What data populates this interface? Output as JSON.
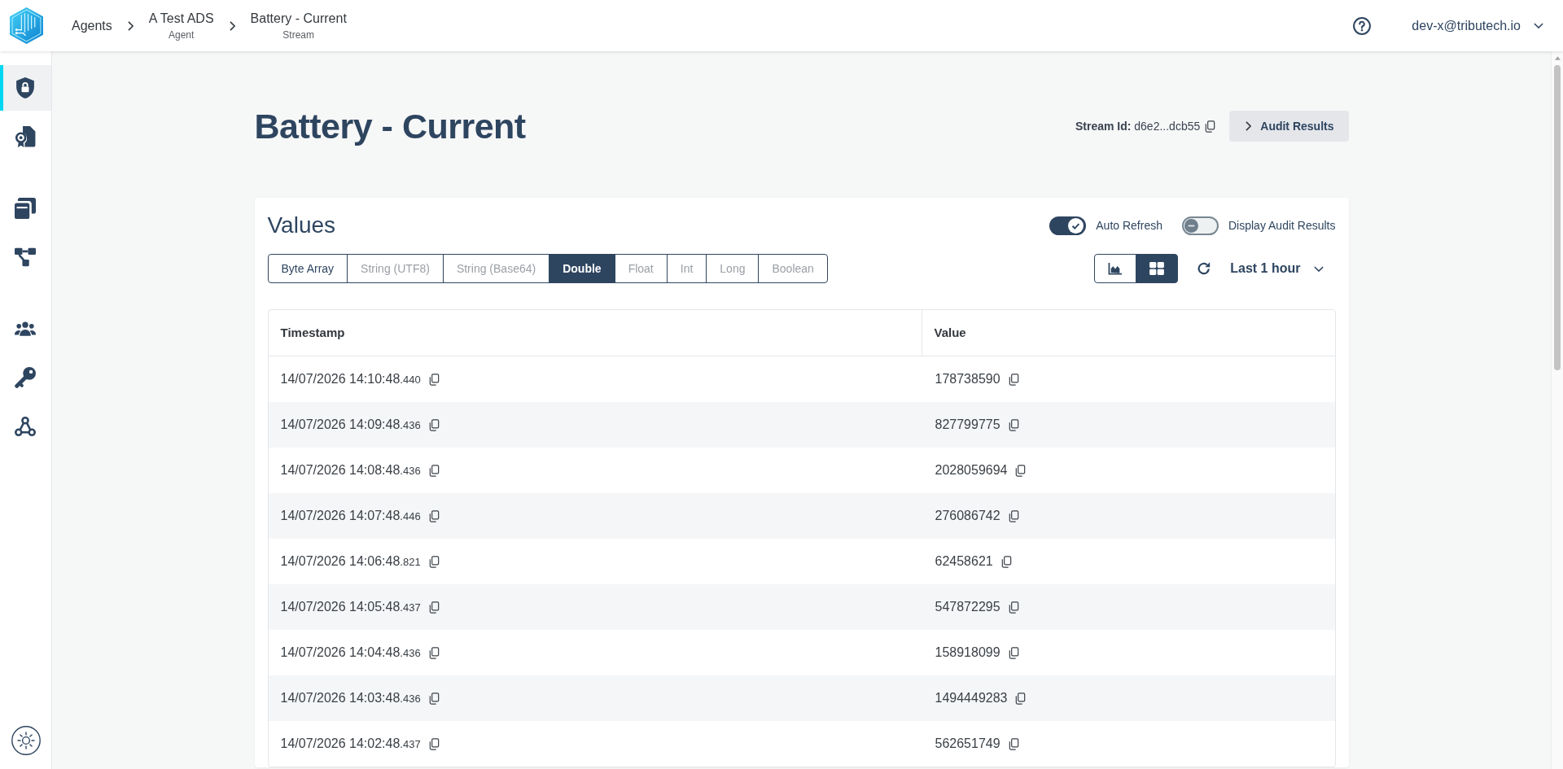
{
  "header": {
    "breadcrumbs": [
      {
        "label": "Agents"
      },
      {
        "label": "A Test ADS",
        "type": "Agent"
      },
      {
        "label": "Battery - Current",
        "type": "Stream"
      }
    ],
    "user": "dev-x@tributech.io"
  },
  "sidebar": {
    "groups": [
      {
        "items": [
          {
            "selected": true
          },
          {
            "selected": false
          }
        ]
      },
      {
        "items": [
          {
            "selected": false
          },
          {
            "selected": false
          }
        ]
      },
      {
        "items": [
          {
            "selected": false
          },
          {
            "selected": false
          },
          {
            "selected": false
          }
        ]
      }
    ]
  },
  "page": {
    "title": "Battery - Current",
    "stream_id": "**Stream Id:** d6e2...dcb55",
    "audit_button": "Audit Results"
  },
  "values_card": {
    "title": "Values",
    "switches": [
      {
        "label": "Auto Refresh",
        "on": true
      },
      {
        "label": "Display Audit Results",
        "on": false
      }
    ],
    "data_types": [
      {
        "label": "Byte Array",
        "selected": false,
        "disabled": false
      },
      {
        "label": "String (UTF8)",
        "selected": false,
        "disabled": true
      },
      {
        "label": "String (Base64)",
        "selected": false,
        "disabled": true
      },
      {
        "label": "Double",
        "selected": true,
        "disabled": false
      },
      {
        "label": "Float",
        "selected": false,
        "disabled": true
      },
      {
        "label": "Int",
        "selected": false,
        "disabled": true
      },
      {
        "label": "Long",
        "selected": false,
        "disabled": true
      },
      {
        "label": "Boolean",
        "selected": false,
        "disabled": true
      }
    ],
    "views": [
      {
        "selected": false
      },
      {
        "selected": true
      }
    ],
    "time_range": "Last 1 hour",
    "table": {
      "columns": [
        "Timestamp",
        "Value"
      ],
      "rows": [
        {
          "timestamp": "14/07/2026 14:10:48",
          "milliseconds": ".440",
          "value": "178738590"
        },
        {
          "timestamp": "14/07/2026 14:09:48",
          "milliseconds": ".436",
          "value": "827799775"
        },
        {
          "timestamp": "14/07/2026 14:08:48",
          "milliseconds": ".436",
          "value": "2028059694"
        },
        {
          "timestamp": "14/07/2026 14:07:48",
          "milliseconds": ".446",
          "value": "276086742"
        },
        {
          "timestamp": "14/07/2026 14:06:48",
          "milliseconds": ".821",
          "value": "62458621"
        },
        {
          "timestamp": "14/07/2026 14:05:48",
          "milliseconds": ".437",
          "value": "547872295"
        },
        {
          "timestamp": "14/07/2026 14:04:48",
          "milliseconds": ".436",
          "value": "158918099"
        },
        {
          "timestamp": "14/07/2026 14:03:48",
          "milliseconds": ".436",
          "value": "1494449283"
        },
        {
          "timestamp": "14/07/2026 14:02:48",
          "milliseconds": ".437",
          "value": "562651749"
        }
      ]
    }
  }
}
